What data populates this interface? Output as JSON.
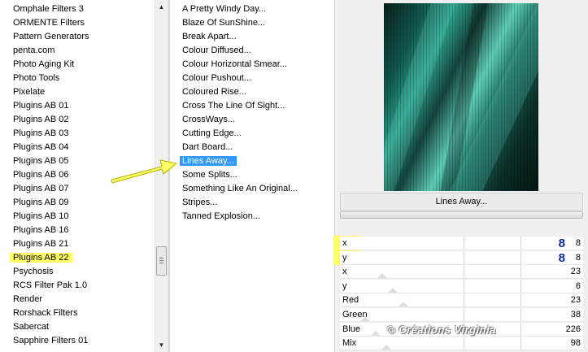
{
  "categories": {
    "items": [
      "Omphale Filters 3",
      "ORMENTE Filters",
      "Pattern Generators",
      "penta.com",
      "Photo Aging Kit",
      "Photo Tools",
      "Pixelate",
      "Plugins AB 01",
      "Plugins AB 02",
      "Plugins AB 03",
      "Plugins AB 04",
      "Plugins AB 05",
      "Plugins AB 06",
      "Plugins AB 07",
      "Plugins AB 09",
      "Plugins AB 10",
      "Plugins AB 16",
      "Plugins AB 21",
      "Plugins AB 22",
      "Psychosis",
      "RCS Filter Pak 1.0",
      "Render",
      "Rorshack Filters",
      "Sabercat",
      "Sapphire Filters 01"
    ],
    "selected": "Plugins AB 22"
  },
  "filters": {
    "items": [
      "A Pretty Windy Day...",
      "Blaze Of SunShine...",
      "Break Apart...",
      "Colour Diffused...",
      "Colour Horizontal Smear...",
      "Colour Pushout...",
      "Coloured Rise...",
      "Cross The Line Of Sight...",
      "CrossWays...",
      "Cutting Edge...",
      "Dart Board...",
      "Lines Away...",
      "Some Splits...",
      "Something Like An Original...",
      "Stripes...",
      "Tanned Explosion..."
    ],
    "selected": "Lines Away..."
  },
  "preview": {
    "filter_name": "Lines Away..."
  },
  "params": [
    {
      "label": "x",
      "value": "8",
      "big": "8"
    },
    {
      "label": "y",
      "value": "8",
      "big": "8"
    },
    {
      "label": "x",
      "value": "23"
    },
    {
      "label": "y",
      "value": "6"
    },
    {
      "label": "Red",
      "value": "23"
    },
    {
      "label": "Green",
      "value": "38"
    },
    {
      "label": "Blue",
      "value": "226"
    },
    {
      "label": "Mix",
      "value": "98"
    }
  ],
  "scrollbar": {
    "up_icon": "arrow-up-icon",
    "down_icon": "arrow-down-icon"
  },
  "colors": {
    "highlight_yellow": "#ffff66",
    "selection_blue": "#3399ff",
    "value_blue": "#0b2a9a",
    "arrow_yellow": "#ffff66"
  },
  "watermark": {
    "text": "© Créations Virginia"
  }
}
